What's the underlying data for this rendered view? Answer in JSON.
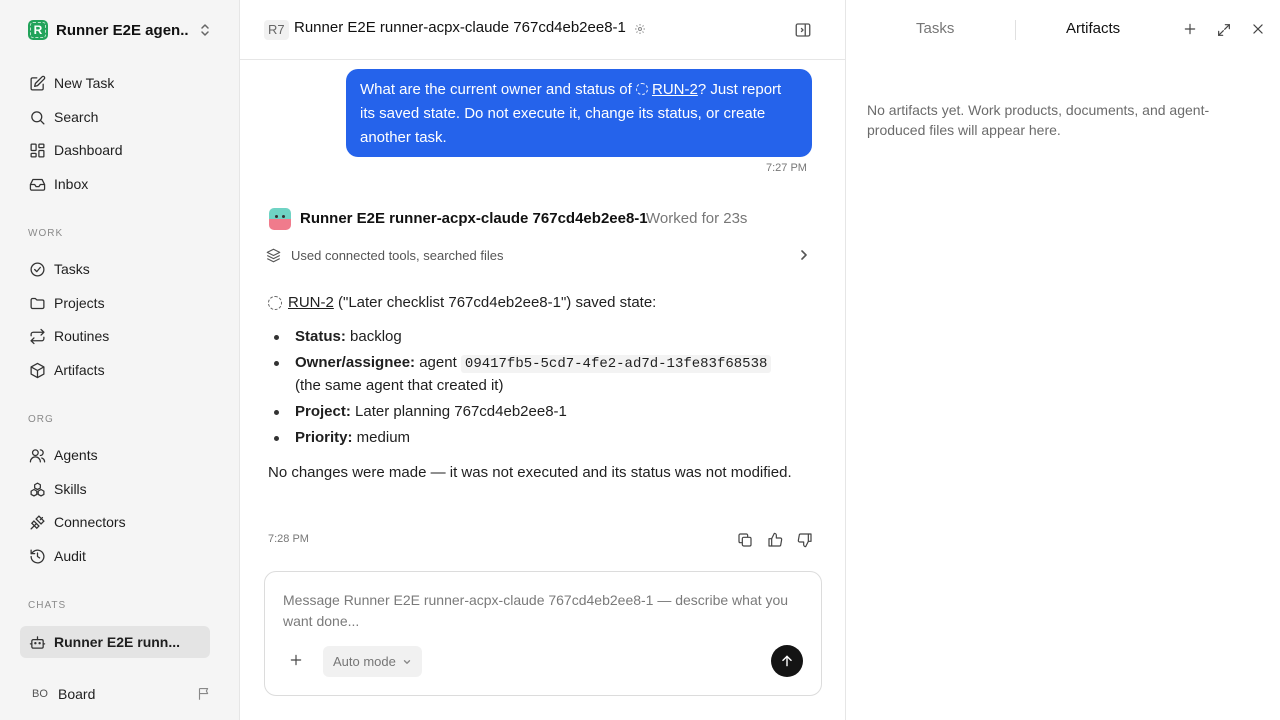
{
  "workspace": {
    "name": "Runner E2E agen...",
    "logo_letter": "R",
    "color": "#22a35a"
  },
  "nav_main": [
    {
      "label": "New Task",
      "icon": "edit-icon"
    },
    {
      "label": "Search",
      "icon": "search-icon"
    },
    {
      "label": "Dashboard",
      "icon": "dashboard-icon"
    },
    {
      "label": "Inbox",
      "icon": "inbox-icon"
    }
  ],
  "sections": {
    "work": "WORK",
    "org": "ORG",
    "chats": "CHATS"
  },
  "nav_work": [
    {
      "label": "Tasks",
      "icon": "check-circle-icon"
    },
    {
      "label": "Projects",
      "icon": "folder-icon"
    },
    {
      "label": "Routines",
      "icon": "repeat-icon"
    },
    {
      "label": "Artifacts",
      "icon": "box-icon"
    }
  ],
  "nav_org": [
    {
      "label": "Agents",
      "icon": "users-icon"
    },
    {
      "label": "Skills",
      "icon": "boxes-icon"
    },
    {
      "label": "Connectors",
      "icon": "plug-icon"
    },
    {
      "label": "Audit",
      "icon": "history-icon"
    }
  ],
  "nav_chats": [
    {
      "label": "Runner E2E runn...",
      "icon": "bot-icon",
      "active": true
    }
  ],
  "board": {
    "initials": "BO",
    "label": "Board"
  },
  "chat": {
    "agent_badge": "R7",
    "title": "Runner E2E runner-acpx-claude 767cd4eb2ee8-1",
    "user_message": {
      "before": "What are the current owner and status of ",
      "link": "RUN-2",
      "after": "? Just report its saved state. Do not execute it, change its status, or create another task.",
      "time": "7:27 PM"
    },
    "agent_message": {
      "agent_name": "Runner E2E runner-acpx-claude 767cd4eb2ee8-1",
      "worked_for": "Worked for 23s",
      "tools_summary": "Used connected tools, searched files",
      "run_link": "RUN-2",
      "heading_rest": " (\"Later checklist 767cd4eb2ee8-1\") saved state:",
      "status_label": "Status:",
      "status_value": " backlog",
      "owner_label": "Owner/assignee:",
      "owner_prefix": " agent ",
      "owner_id": "09417fb5-5cd7-4fe2-ad7d-13fe83f68538",
      "owner_suffix": "(the same agent that created it)",
      "project_label": "Project:",
      "project_value": " Later planning 767cd4eb2ee8-1",
      "priority_label": "Priority:",
      "priority_value": " medium",
      "closing": "No changes were made — it was not executed and its status was not modified.",
      "time": "7:28 PM"
    },
    "composer": {
      "placeholder": "Message Runner E2E runner-acpx-claude 767cd4eb2ee8-1 — describe what you want done...",
      "mode": "Auto mode"
    },
    "accent_color": "#2563eb"
  },
  "right_panel": {
    "tabs": [
      "Tasks",
      "Artifacts"
    ],
    "active_tab": "Artifacts",
    "empty_text": "No artifacts yet. Work products, documents, and agent-produced files will appear here."
  }
}
